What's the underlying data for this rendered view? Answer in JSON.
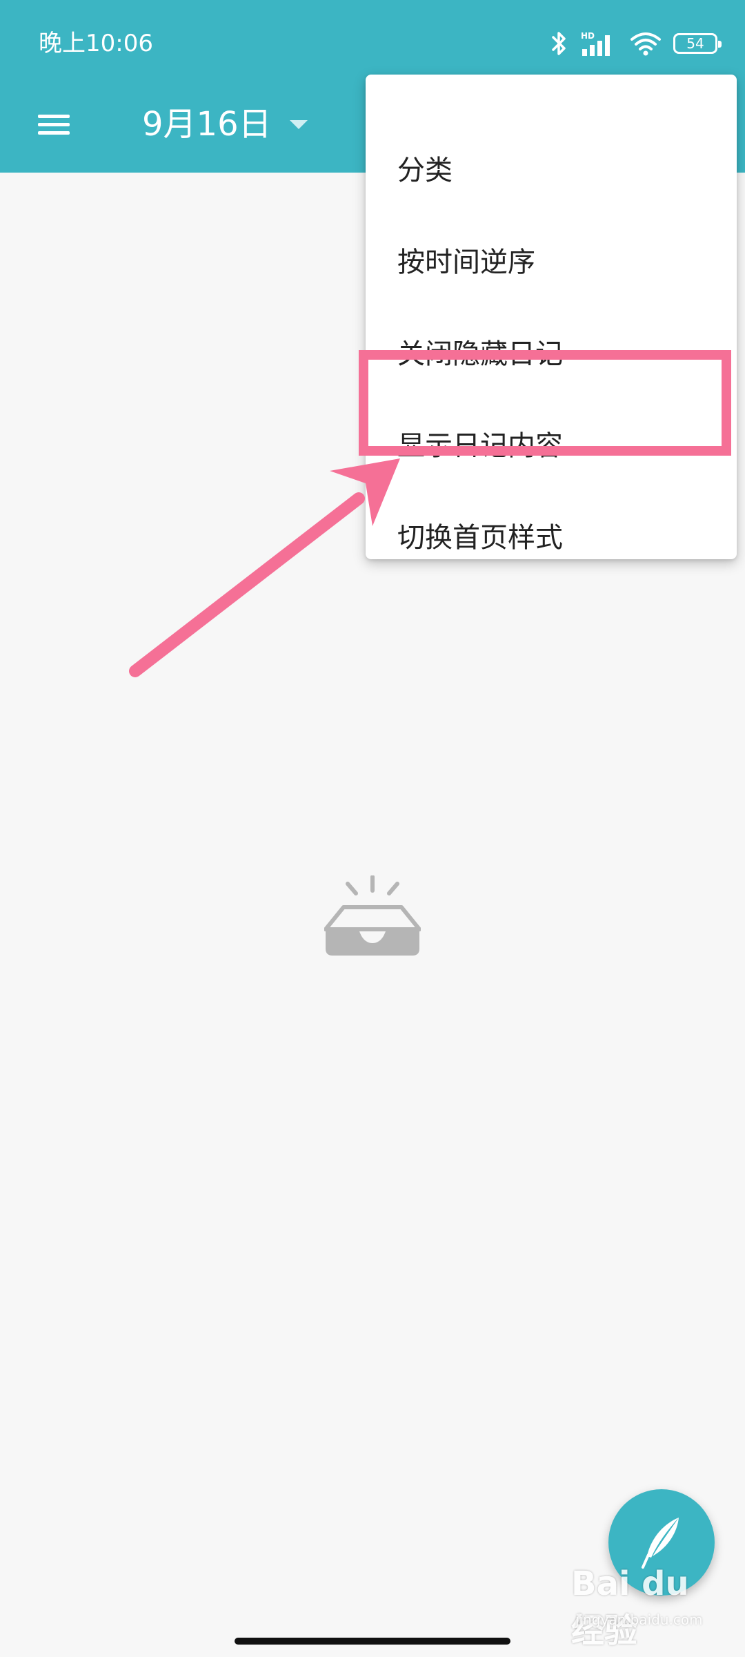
{
  "status_bar": {
    "time": "晚上10:06",
    "battery": "54",
    "network_label": "HD"
  },
  "toolbar": {
    "date_title": "9月16日"
  },
  "overflow_menu": {
    "items": [
      {
        "label": "分类"
      },
      {
        "label": "按时间逆序"
      },
      {
        "label": "关闭隐藏日记"
      },
      {
        "label": "显示日记内容"
      },
      {
        "label": "切换首页样式"
      }
    ],
    "highlighted_index": 3
  },
  "watermark": {
    "text": "Bai du 经验",
    "sub": "jingyan.baidu.com"
  },
  "colors": {
    "accent": "#3cb5c3",
    "highlight": "#f57096",
    "background": "#f7f7f7",
    "empty_icon": "#b5b5b5"
  }
}
